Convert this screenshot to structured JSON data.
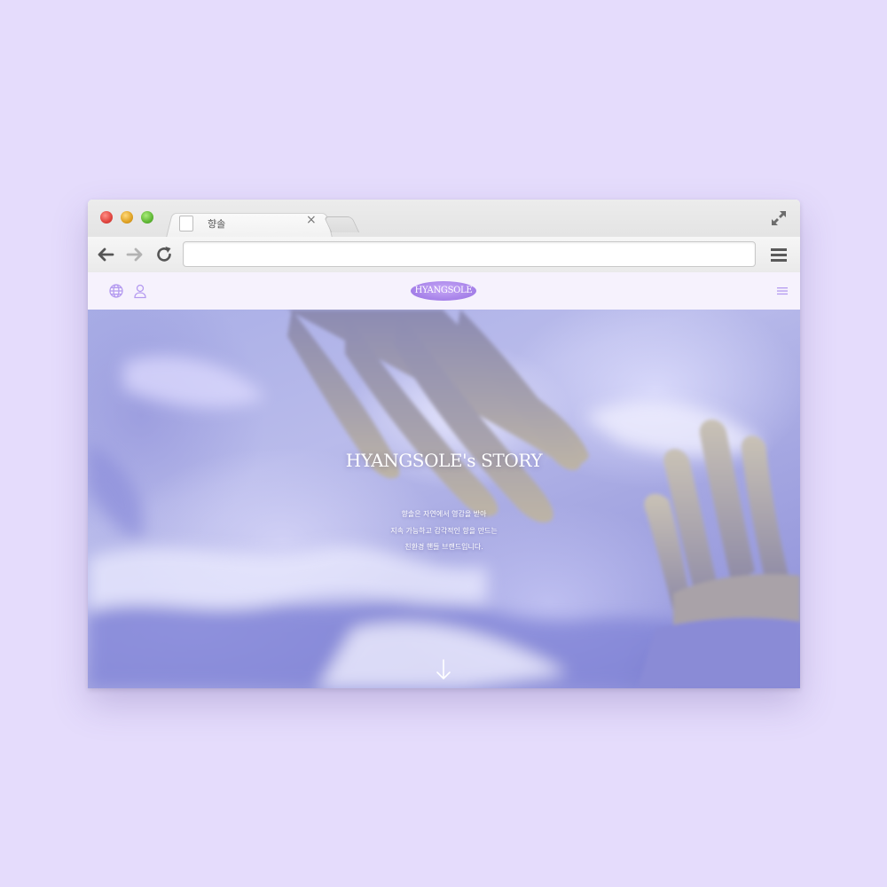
{
  "browser": {
    "tab_title": "향솔",
    "tab_close": "×",
    "url": ""
  },
  "site": {
    "logo_text": "HYANGSOLE",
    "accent_color": "#a47fe8"
  },
  "hero": {
    "title": "HYANGSOLE's STORY",
    "lines": [
      "향솔은 자연에서 영감을 받아",
      "지속 가능하고 감각적인 향을 만드는",
      "친환경 핸들 브랜드입니다."
    ]
  },
  "icons": {
    "header_left": [
      "globe-icon",
      "user-icon"
    ],
    "header_right": "menu-icon",
    "scroll": "arrow-down-icon"
  }
}
